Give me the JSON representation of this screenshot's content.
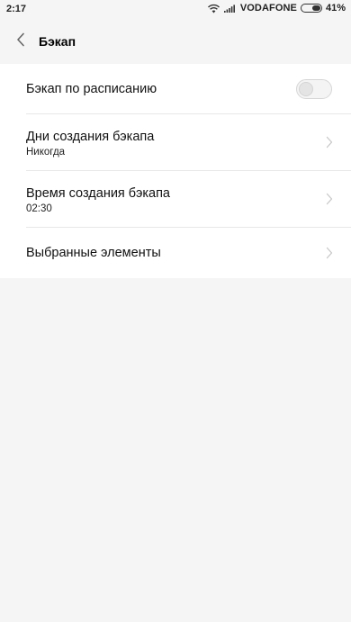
{
  "status_bar": {
    "time": "2:17",
    "carrier": "VODAFONE",
    "battery": "41%",
    "icons": [
      "wifi-icon",
      "signal-icon",
      "battery-icon"
    ]
  },
  "header": {
    "title": "Бэкап",
    "back_icon": "chevron-left-icon"
  },
  "settings": {
    "scheduled_backup": {
      "label": "Бэкап по расписанию",
      "enabled": false
    },
    "backup_days": {
      "label": "Дни создания бэкапа",
      "value": "Никогда"
    },
    "backup_time": {
      "label": "Время создания бэкапа",
      "value": "02:30"
    },
    "selected_items": {
      "label": "Выбранные элементы"
    }
  }
}
